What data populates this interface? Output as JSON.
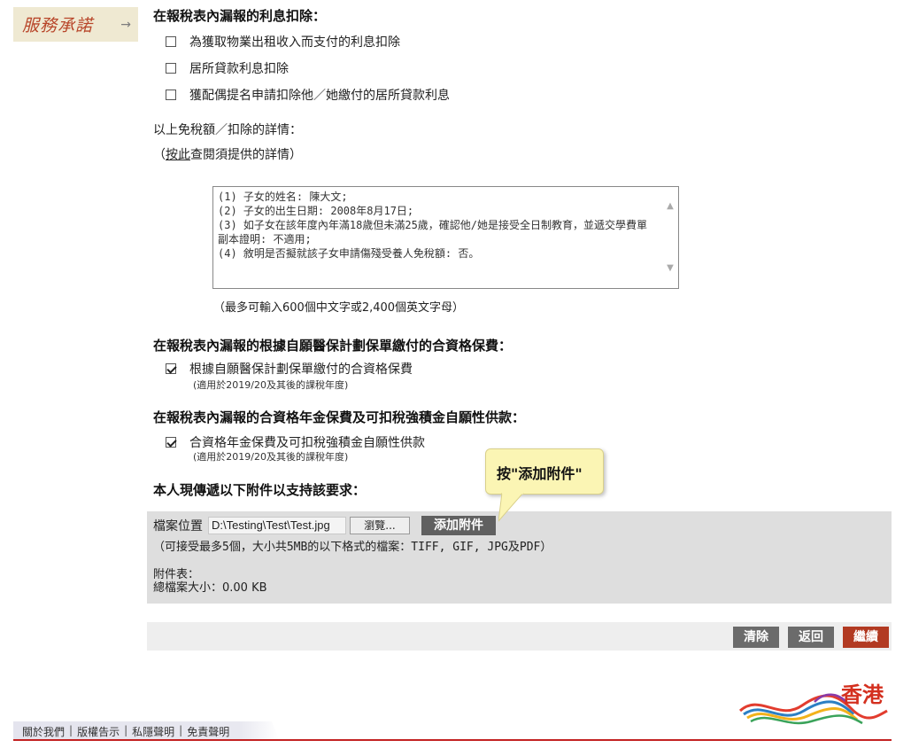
{
  "sidebar": {
    "pledge_text": "服務承諾",
    "pledge_arrow": "→"
  },
  "sections": {
    "interest": {
      "title": "在報稅表內漏報的利息扣除：",
      "items": [
        {
          "label": "為獲取物業出租收入而支付的利息扣除",
          "checked": false
        },
        {
          "label": "居所貸款利息扣除",
          "checked": false
        },
        {
          "label": "獲配偶提名申請扣除他／她繳付的居所貸款利息",
          "checked": false
        }
      ]
    },
    "details": {
      "heading": "以上免稅額／扣除的詳情：",
      "hint_prefix": "（",
      "hint_link": "按此",
      "hint_suffix": "查閱須提供的詳情）",
      "textarea_value": "(1) 子女的姓名: 陳大文;\n(2) 子女的出生日期: 2008年8月17日;\n(3) 如子女在該年度內年滿18歲但未滿25歲，確認他/她是接受全日制教育，並遞交學費單副本證明: 不適用;\n(4) 敘明是否擬就該子女申請傷殘受養人免稅額: 否。",
      "limit_note": "（最多可輸入600個中文字或2,400個英文字母）"
    },
    "vhis": {
      "title": "在報稅表內漏報的根據自願醫保計劃保單繳付的合資格保費：",
      "item_label": "根據自願醫保計劃保單繳付的合資格保費",
      "item_note": "(適用於2019/20及其後的課稅年度)",
      "checked": true
    },
    "annuity": {
      "title": "在報稅表內漏報的合資格年金保費及可扣稅強積金自願性供款：",
      "item_label": "合資格年金保費及可扣稅強積金自願性供款",
      "item_note": "(適用於2019/20及其後的課稅年度)",
      "checked": true
    },
    "attachments": {
      "title": "本人現傳遞以下附件以支持該要求：",
      "file_label": "檔案位置",
      "file_value": "D:\\Testing\\Test\\Test.jpg",
      "browse_label": "瀏覽...",
      "add_label": "添加附件",
      "accept_note": "（可接受最多5個，大小共5MB的以下格式的檔案：TIFF, GIF, JPG及PDF）",
      "list_label": "附件表：",
      "total_size": "總檔案大小：0.00 KB"
    }
  },
  "callout": {
    "text": "按\"添加附件\""
  },
  "actions": {
    "clear": "清除",
    "back": "返回",
    "continue": "繼續"
  },
  "colors": {
    "clear_bg": "#6b6b6b",
    "back_bg": "#6b6b6b",
    "continue_bg": "#b23a22",
    "footer_line": "#c32222"
  },
  "footer": {
    "links": [
      "關於我們",
      "版權告示",
      "私隱聲明",
      "免責聲明"
    ],
    "separator": "|",
    "logo_text": "香港"
  }
}
